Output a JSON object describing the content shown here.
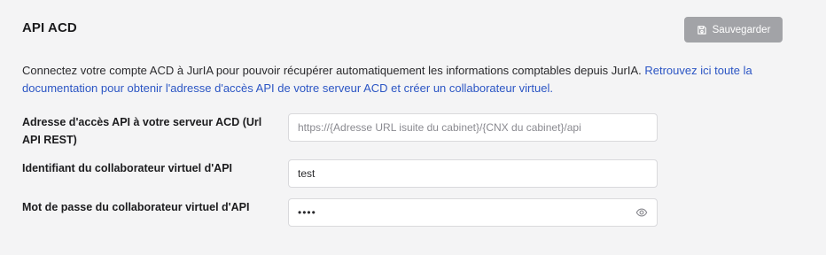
{
  "section": {
    "title": "API ACD",
    "save_label": "Sauvegarder",
    "description_text": "Connectez votre compte ACD à JurIA pour pouvoir récupérer automatiquement les informations comptables depuis JurIA. ",
    "description_link": "Retrouvez ici toute la documentation pour obtenir l'adresse d'accès API de votre serveur ACD et créer un collaborateur virtuel."
  },
  "fields": {
    "url": {
      "label": "Adresse d'accès API à votre serveur ACD (Url API REST)",
      "placeholder": "https://{Adresse URL isuite du cabinet}/{CNX du cabinet}/api",
      "value": ""
    },
    "identifier": {
      "label": "Identifiant du collaborateur virtuel d'API",
      "placeholder": "",
      "value": "test"
    },
    "password": {
      "label": "Mot de passe du collaborateur virtuel d'API",
      "value": "test"
    }
  },
  "icons": {
    "save": "floppy-disk-icon",
    "show_password": "eye-icon"
  },
  "colors": {
    "background": "#f4f4f5",
    "button_disabled": "#a2a3a7",
    "link": "#2b55c4"
  }
}
